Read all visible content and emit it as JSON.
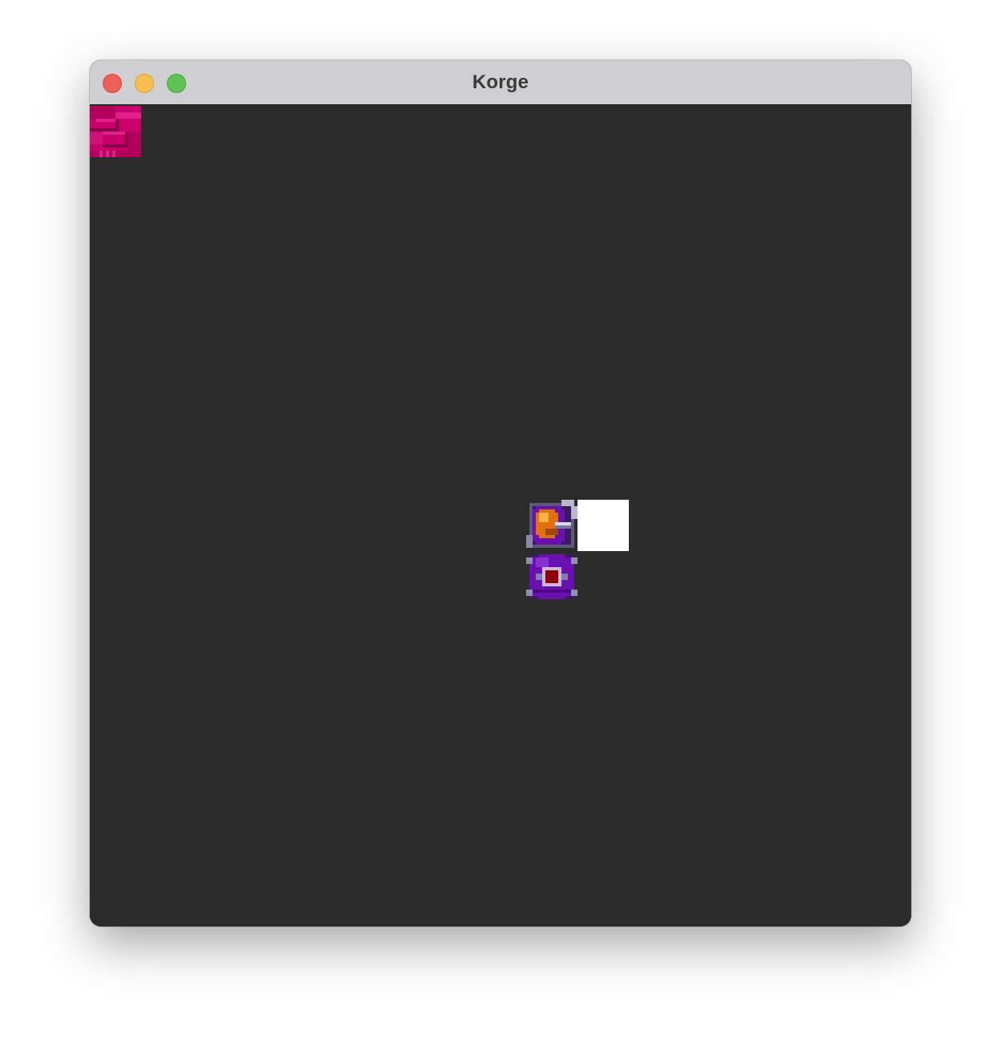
{
  "window": {
    "title": "Korge"
  },
  "colors": {
    "stage_background": "#2b2b2b",
    "titlebar": "#cfcfd1",
    "tile_magenta": "#c8006a",
    "orb_purple": "#6a0fb0",
    "orb_orange": "#e07010",
    "core_red": "#8b0000",
    "block_white": "#ffffff"
  },
  "stage": {
    "sprites": [
      {
        "id": "magenta-tile",
        "icon": "magenta-brick-tile-icon"
      },
      {
        "id": "orb-cannon",
        "icon": "purple-orb-orange-core-icon"
      },
      {
        "id": "white-block",
        "icon": "white-square-icon"
      },
      {
        "id": "orb-red-core",
        "icon": "purple-orb-red-core-icon"
      }
    ]
  }
}
